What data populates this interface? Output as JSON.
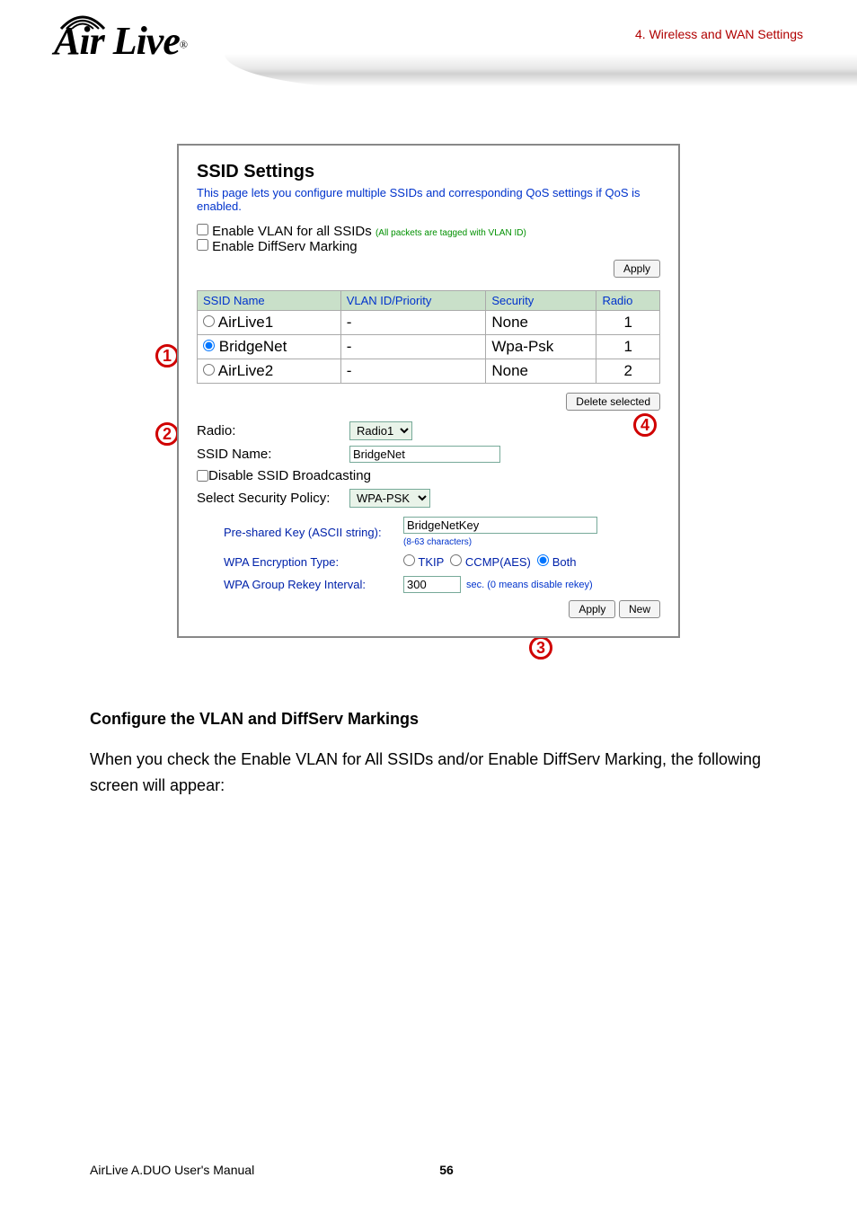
{
  "header": {
    "logo_brand": "Air Live",
    "chapter_label": "4. Wireless and WAN Settings"
  },
  "panel": {
    "title": "SSID Settings",
    "desc": "This page lets you configure multiple SSIDs and corresponding QoS settings if QoS is enabled.",
    "chk_vlan_label": "Enable VLAN for all SSIDs",
    "chk_vlan_hint": "(All packets are tagged with VLAN ID)",
    "chk_diffserv_label": "Enable DiffServ Marking",
    "apply_label": "Apply",
    "table": {
      "headers": {
        "name": "SSID Name",
        "vlan": "VLAN ID/Priority",
        "security": "Security",
        "radio": "Radio"
      },
      "rows": [
        {
          "name": "AirLive1",
          "vlan": "-",
          "security": "None",
          "radio": "1",
          "selected": false
        },
        {
          "name": "BridgeNet",
          "vlan": "-",
          "security": "Wpa-Psk",
          "radio": "1",
          "selected": true
        },
        {
          "name": "AirLive2",
          "vlan": "-",
          "security": "None",
          "radio": "2",
          "selected": false
        }
      ]
    },
    "delete_selected_label": "Delete selected",
    "form": {
      "radio_label": "Radio:",
      "radio_value": "Radio1",
      "ssid_name_label": "SSID Name:",
      "ssid_name_value": "BridgeNet",
      "disable_broadcast_label": "Disable SSID Broadcasting",
      "security_policy_label": "Select Security Policy:",
      "security_policy_value": "WPA-PSK"
    },
    "wpa": {
      "psk_label": "Pre-shared Key (ASCII string):",
      "psk_value": "BridgeNetKey",
      "psk_hint": "(8-63 characters)",
      "enc_label": "WPA Encryption Type:",
      "enc_tkip": "TKIP",
      "enc_ccmp": "CCMP(AES)",
      "enc_both": "Both",
      "rekey_label": "WPA Group Rekey Interval:",
      "rekey_value": "300",
      "rekey_unit": "sec.",
      "rekey_hint": "(0 means disable rekey)"
    },
    "apply2_label": "Apply",
    "new_label": "New"
  },
  "callouts": {
    "c1": "1",
    "c2": "2",
    "c3": "3",
    "c4": "4"
  },
  "body_text": {
    "heading": "Configure the VLAN and DiffServ Markings",
    "para": "When you check the Enable VLAN for All SSIDs and/or Enable DiffServ Marking, the following screen will appear:"
  },
  "footer": {
    "left": "AirLive A.DUO User's Manual",
    "page": "56"
  }
}
